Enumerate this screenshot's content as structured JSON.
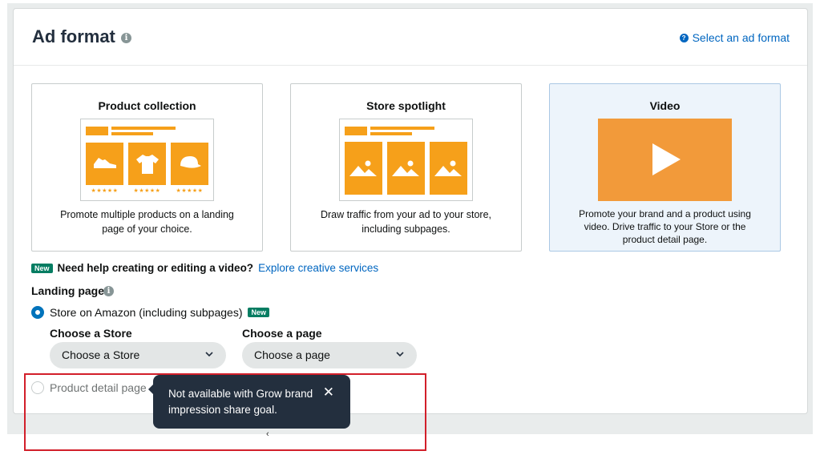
{
  "header": {
    "title": "Ad format",
    "help_link": "Select an ad format"
  },
  "formats": [
    {
      "label": "Product collection",
      "description_line1": "Promote multiple products on a landing",
      "description_line2": "page of your choice.",
      "selected": false
    },
    {
      "label": "Store spotlight",
      "description_line1": "Draw traffic from your ad to your store,",
      "description_line2": "including subpages.",
      "selected": false
    },
    {
      "label": "Video",
      "description_line1": "Promote your brand and a product using",
      "description_line2": "video. Drive traffic to your Store or the",
      "description_line3": "product detail page.",
      "selected": true
    }
  ],
  "product_collection": {
    "ratings": [
      "★★★★★",
      "★★★★★",
      "★★★★★"
    ]
  },
  "creative_help": {
    "badge": "New",
    "text": "Need help creating or editing a video?",
    "link": "Explore creative services"
  },
  "landing_page": {
    "label": "Landing page",
    "options": [
      {
        "label": "Store on Amazon (including subpages)",
        "badge": "New",
        "checked": true,
        "disabled": false
      },
      {
        "label": "Product detail page",
        "checked": false,
        "disabled": true
      }
    ],
    "store_select": {
      "label": "Choose a Store",
      "value": "Choose a Store"
    },
    "page_select": {
      "label": "Choose a page",
      "value": "Choose a page"
    }
  },
  "tooltip": {
    "line1": "Not available with Grow brand",
    "line2": "impression share goal.",
    "close": "✕"
  },
  "colors": {
    "accent": "#0066c0",
    "orange": "#f6a01a",
    "video_orange": "#f29a3a",
    "badge_green": "#067d62",
    "tooltip_bg": "#232f3e",
    "highlight": "#d21f2a"
  }
}
